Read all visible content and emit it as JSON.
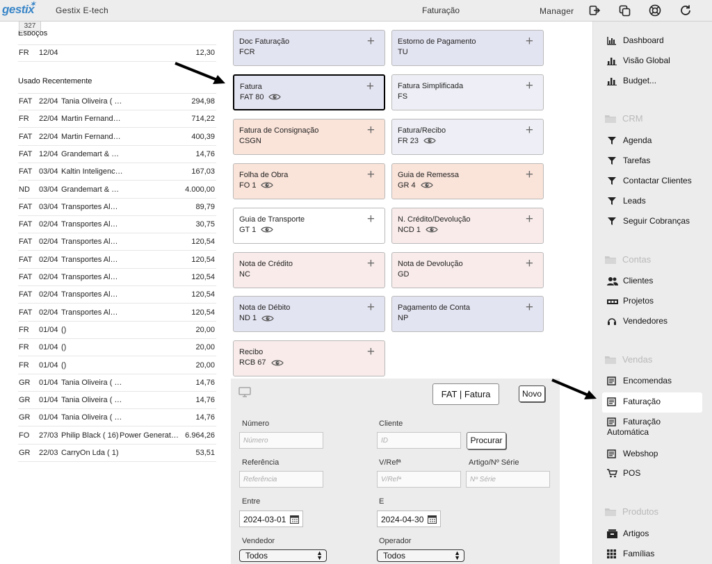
{
  "topbar": {
    "logo": "gestix",
    "company": "Gestix E-tech",
    "page_title": "Faturação",
    "user": "Manager",
    "badge": "327"
  },
  "left": {
    "drafts_title": "Esboços",
    "draft_rows": [
      {
        "type": "FR",
        "date": "12/04",
        "name": "",
        "desc": "",
        "amount": "12,30"
      }
    ],
    "recent_title": "Usado Recentemente",
    "recent_rows": [
      {
        "type": "FAT",
        "date": "22/04",
        "name": "Tania Oliveira ( …",
        "desc": "",
        "amount": "294,98"
      },
      {
        "type": "FR",
        "date": "22/04",
        "name": "Martin Fernand…",
        "desc": "",
        "amount": "714,22"
      },
      {
        "type": "FAT",
        "date": "22/04",
        "name": "Martin Fernand…",
        "desc": "",
        "amount": "400,39"
      },
      {
        "type": "FAT",
        "date": "12/04",
        "name": "Grandemart & …",
        "desc": "",
        "amount": "14,76"
      },
      {
        "type": "FAT",
        "date": "03/04",
        "name": "Kaltin Inteligenc…",
        "desc": "",
        "amount": "167,03"
      },
      {
        "type": "ND",
        "date": "03/04",
        "name": "Grandemart & …",
        "desc": "",
        "amount": "4.000,00"
      },
      {
        "type": "FAT",
        "date": "03/04",
        "name": "Transportes Al…",
        "desc": "",
        "amount": "89,79"
      },
      {
        "type": "FAT",
        "date": "02/04",
        "name": "Transportes Al…",
        "desc": "",
        "amount": "30,75"
      },
      {
        "type": "FAT",
        "date": "02/04",
        "name": "Transportes Al…",
        "desc": "",
        "amount": "120,54"
      },
      {
        "type": "FAT",
        "date": "02/04",
        "name": "Transportes Al…",
        "desc": "",
        "amount": "120,54"
      },
      {
        "type": "FAT",
        "date": "02/04",
        "name": "Transportes Al…",
        "desc": "",
        "amount": "120,54"
      },
      {
        "type": "FAT",
        "date": "02/04",
        "name": "Transportes Al…",
        "desc": "",
        "amount": "120,54"
      },
      {
        "type": "FAT",
        "date": "02/04",
        "name": "Transportes Al…",
        "desc": "",
        "amount": "120,54"
      },
      {
        "type": "FR",
        "date": "01/04",
        "name": "()",
        "desc": "",
        "amount": "20,00"
      },
      {
        "type": "FR",
        "date": "01/04",
        "name": "()",
        "desc": "",
        "amount": "20,00"
      },
      {
        "type": "FR",
        "date": "01/04",
        "name": "()",
        "desc": "",
        "amount": "20,00"
      },
      {
        "type": "GR",
        "date": "01/04",
        "name": "Tania Oliveira ( …",
        "desc": "",
        "amount": "14,76"
      },
      {
        "type": "GR",
        "date": "01/04",
        "name": "Tania Oliveira ( …",
        "desc": "",
        "amount": "14,76"
      },
      {
        "type": "GR",
        "date": "01/04",
        "name": "Tania Oliveira ( …",
        "desc": "",
        "amount": "14,76"
      },
      {
        "type": "FO",
        "date": "27/03",
        "name": "Philip Black ( 16)",
        "desc": "Power Generat…",
        "amount": "6.964,26"
      },
      {
        "type": "GR",
        "date": "22/03",
        "name": "CarryOn Lda ( 1)",
        "desc": "",
        "amount": "53,51"
      }
    ]
  },
  "tiles": [
    {
      "title": "Doc Faturação",
      "code": "FCR",
      "eye": false,
      "color": "blue"
    },
    {
      "title": "Estorno de Pagamento",
      "code": "TU",
      "eye": false,
      "color": "blue"
    },
    {
      "title": "Fatura",
      "code": "FAT 80",
      "eye": true,
      "color": "blue",
      "selected": true
    },
    {
      "title": "Fatura Simplificada",
      "code": "FS",
      "eye": false,
      "color": "lblue"
    },
    {
      "title": "Fatura de Consignação",
      "code": "CSGN",
      "eye": false,
      "color": "orange"
    },
    {
      "title": "Fatura/Recibo",
      "code": "FR 23",
      "eye": true,
      "color": "lblue"
    },
    {
      "title": "Folha de Obra",
      "code": "FO 1",
      "eye": true,
      "color": "orange"
    },
    {
      "title": "Guia de Remessa",
      "code": "GR 4",
      "eye": true,
      "color": "orange"
    },
    {
      "title": "Guia de Transporte",
      "code": "GT 1",
      "eye": true,
      "color": "white"
    },
    {
      "title": "N. Crédito/Devolução",
      "code": "NCD 1",
      "eye": true,
      "color": "pink"
    },
    {
      "title": "Nota de Crédito",
      "code": "NC",
      "eye": false,
      "color": "pink"
    },
    {
      "title": "Nota de Devolução",
      "code": "GD",
      "eye": false,
      "color": "pink"
    },
    {
      "title": "Nota de Débito",
      "code": "ND 1",
      "eye": true,
      "color": "blue"
    },
    {
      "title": "Pagamento de Conta",
      "code": "NP",
      "eye": false,
      "color": "blue"
    },
    {
      "title": "Recibo",
      "code": "RCB 67",
      "eye": true,
      "color": "pink"
    }
  ],
  "search": {
    "doc_button": "FAT | Fatura",
    "novo_button": "Novo",
    "numero_label": "Número",
    "numero_placeholder": "Número",
    "cliente_label": "Cliente",
    "cliente_placeholder": "ID",
    "procurar_button": "Procurar",
    "referencia_label": "Referência",
    "referencia_placeholder": "Referência",
    "vref_label": "V/Refª",
    "vref_placeholder": "V/Refª",
    "artigo_label": "Artigo/Nº Série",
    "artigo_placeholder": "Nº Série",
    "entre_label": "Entre",
    "entre_value": "2024-03-01",
    "e_label": "E",
    "e_value": "2024-04-30",
    "vendedor_label": "Vendedor",
    "vendedor_value": "Todos",
    "operador_label": "Operador",
    "operador_value": "Todos"
  },
  "sidebar": {
    "items": [
      {
        "kind": "item",
        "label": "Dashboard",
        "icon": "chart-icon"
      },
      {
        "kind": "item",
        "label": "Visão Global",
        "icon": "bar-chart-icon"
      },
      {
        "kind": "item",
        "label": "Budget...",
        "icon": "bar-chart-icon"
      },
      {
        "kind": "head",
        "label": "CRM",
        "icon": "folder-icon"
      },
      {
        "kind": "item",
        "label": "Agenda",
        "icon": "funnel-icon"
      },
      {
        "kind": "item",
        "label": "Tarefas",
        "icon": "funnel-icon"
      },
      {
        "kind": "item",
        "label": "Contactar Clientes",
        "icon": "funnel-icon"
      },
      {
        "kind": "item",
        "label": "Leads",
        "icon": "funnel-icon"
      },
      {
        "kind": "item",
        "label": "Seguir Cobranças",
        "icon": "funnel-icon"
      },
      {
        "kind": "head",
        "label": "Contas",
        "icon": "folder-icon"
      },
      {
        "kind": "item",
        "label": "Clientes",
        "icon": "users-icon"
      },
      {
        "kind": "item",
        "label": "Projetos",
        "icon": "projects-icon"
      },
      {
        "kind": "item",
        "label": "Vendedores",
        "icon": "headset-icon"
      },
      {
        "kind": "head",
        "label": "Vendas",
        "icon": "folder-icon"
      },
      {
        "kind": "item",
        "label": "Encomendas",
        "icon": "document-icon"
      },
      {
        "kind": "item",
        "label": "Faturação",
        "icon": "document-icon",
        "active": true
      },
      {
        "kind": "item",
        "label": "Faturação Automática",
        "icon": "document-icon"
      },
      {
        "kind": "item",
        "label": "Webshop",
        "icon": "document-icon"
      },
      {
        "kind": "item",
        "label": "POS",
        "icon": "cart-icon"
      },
      {
        "kind": "head",
        "label": "Produtos",
        "icon": "folder-icon"
      },
      {
        "kind": "item",
        "label": "Artigos",
        "icon": "box-icon"
      },
      {
        "kind": "item",
        "label": "Famílias",
        "icon": "grid-icon"
      }
    ]
  },
  "colors": {
    "accent": "#3a86c8",
    "tile_blue": "#e3e4f1",
    "tile_pink": "#f8ebea",
    "tile_orange": "#fae3d9",
    "sidebar_bg": "#ececec"
  }
}
